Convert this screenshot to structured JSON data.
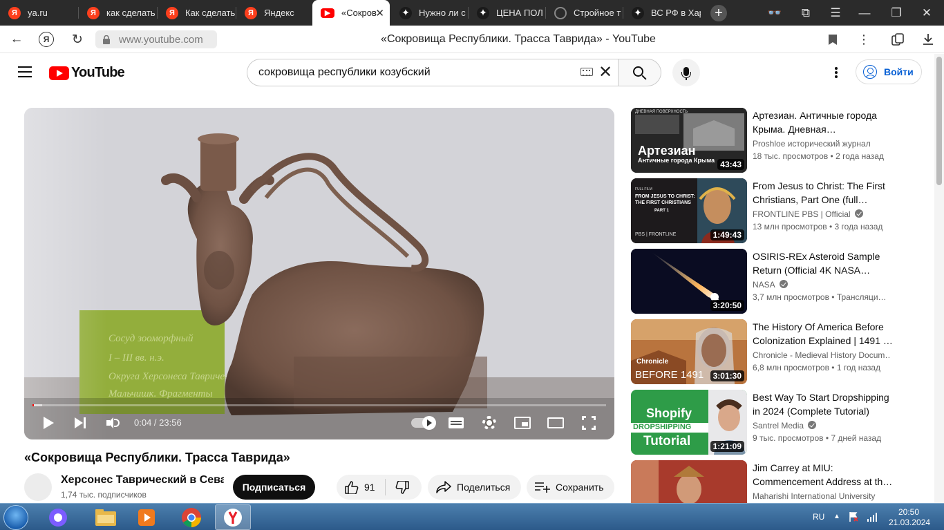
{
  "browser": {
    "tabs": [
      {
        "label": "ya.ru",
        "favicon": "yandex-icon"
      },
      {
        "label": "как сделать",
        "favicon": "yandex-icon"
      },
      {
        "label": "Как сделать",
        "favicon": "yandex-icon"
      },
      {
        "label": "Яндекс",
        "favicon": "yandex-icon"
      },
      {
        "label": "«Сокров",
        "favicon": "youtube-icon",
        "active": true
      },
      {
        "label": "Нужно ли с",
        "favicon": "spark-icon"
      },
      {
        "label": "ЦЕНА ПОЛ",
        "favicon": "spark-icon"
      },
      {
        "label": "Стройное т",
        "favicon": "ring-icon"
      },
      {
        "label": "ВС РФ в Хар",
        "favicon": "spark-icon"
      }
    ],
    "url_display": "www.youtube.com",
    "page_title": "«Сокровища Республики. Трасса Таврида» - YouTube"
  },
  "masthead": {
    "logo_text": "YouTube",
    "search_value": "сокровища республики козубский",
    "signin_label": "Войти"
  },
  "player": {
    "time_current": "0:04",
    "time_total": "23:56",
    "time_display": "0:04 / 23:56",
    "progress_fraction": 0.003,
    "buffered_fraction": 0.017,
    "museum_label_lines": [
      "Сосуд зооморфный",
      "I – III вв. н.э.",
      "Округа Херсонеса Таврического",
      "Мальчишк. Фрагменты"
    ]
  },
  "video": {
    "title": "«Сокровища Республики. Трасса Таврида»",
    "channel_name": "Херсонес Таврический в Сева",
    "channel_subscribers": "1,74 тыс. подписчиков",
    "subscribe_label": "Подписаться",
    "like_count": "91",
    "share_label": "Поделиться",
    "save_label": "Сохранить"
  },
  "recommendations": [
    {
      "title": "Артезиан. Античные города Крыма. Дневная…",
      "channel": "Proshloe исторический журнал",
      "views": "18 тыс. просмотров",
      "age": "2 года назад",
      "duration": "43:43",
      "verified": false,
      "thumb_text_main": "Артезиан",
      "thumb_text_sub": "Античные города Крыма",
      "thumb_text_top": "ДНЕВНАЯ ПОВЕРХНОСТЬ"
    },
    {
      "title": "From Jesus to Christ: The First Christians, Part One (full…",
      "channel": "FRONTLINE PBS | Official",
      "views": "13 млн просмотров",
      "age": "3 года назад",
      "duration": "1:49:43",
      "verified": true,
      "thumb_text_main": "FROM JESUS TO CHRIST: THE FIRST CHRISTIANS",
      "thumb_text_sub": "PART 1",
      "thumb_text_top": "FULL FILM",
      "thumb_text_brand": "PBS | FRONTLINE"
    },
    {
      "title": "OSIRIS-REx Asteroid Sample Return (Official 4K NASA…",
      "channel": "NASA",
      "views": "3,7 млн просмотров",
      "age": "Трансляци…",
      "duration": "3:20:50",
      "verified": true
    },
    {
      "title": "The History Of America Before Colonization Explained | 1491 …",
      "channel": "Chronicle - Medieval History Docum…",
      "views": "6,8 млн просмотров",
      "age": "1 год назад",
      "duration": "3:01:30",
      "verified": false,
      "thumb_text_main": "BEFORE 1491",
      "thumb_text_top": "Chronicle"
    },
    {
      "title": "Best Way To Start Dropshipping in 2024 (Complete Tutorial)",
      "channel": "Santrel Media",
      "views": "9 тыс. просмотров",
      "age": "7 дней назад",
      "duration": "1:21:09",
      "verified": true,
      "thumb_text_main": "Shopify",
      "thumb_text_sub": "DROPSHIPPING",
      "thumb_text_top": "Tutorial"
    },
    {
      "title": "Jim Carrey at MIU: Commencement Address at th…",
      "channel": "Maharishi International University",
      "views": "",
      "age": "",
      "duration": "",
      "verified": false
    }
  ],
  "taskbar": {
    "apps": [
      "start-orb",
      "alice-icon",
      "file-explorer-icon",
      "media-player-icon",
      "chrome-icon",
      "yandex-browser-icon"
    ],
    "language": "RU",
    "time": "20:50",
    "date": "21.03.2024"
  },
  "colors": {
    "yt_red": "#ff0000",
    "link_blue": "#065fd4",
    "subscribe_bg": "#0f0f0f",
    "taskbar_blue": "#2c5a8a"
  }
}
